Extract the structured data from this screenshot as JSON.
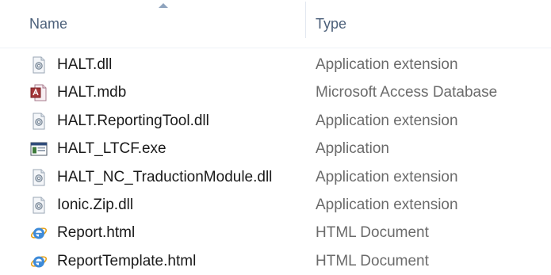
{
  "columns": {
    "name_label": "Name",
    "type_label": "Type",
    "sorted_by": "name",
    "sort_direction": "ascending"
  },
  "files": [
    {
      "name": "HALT.dll",
      "type": "Application extension",
      "icon": "dll-icon"
    },
    {
      "name": "HALT.mdb",
      "type": "Microsoft Access Database",
      "icon": "access-database-icon"
    },
    {
      "name": "HALT.ReportingTool.dll",
      "type": "Application extension",
      "icon": "dll-icon"
    },
    {
      "name": "HALT_LTCF.exe",
      "type": "Application",
      "icon": "application-exe-icon"
    },
    {
      "name": "HALT_NC_TraductionModule.dll",
      "type": "Application extension",
      "icon": "dll-icon"
    },
    {
      "name": "Ionic.Zip.dll",
      "type": "Application extension",
      "icon": "dll-icon"
    },
    {
      "name": "Report.html",
      "type": "HTML Document",
      "icon": "internet-explorer-icon"
    },
    {
      "name": "ReportTemplate.html",
      "type": "HTML Document",
      "icon": "internet-explorer-icon"
    }
  ],
  "colors": {
    "header_text": "#4c607a",
    "name_text": "#1a1a1a",
    "type_text": "#6b6b6b",
    "background": "#ffffff"
  }
}
